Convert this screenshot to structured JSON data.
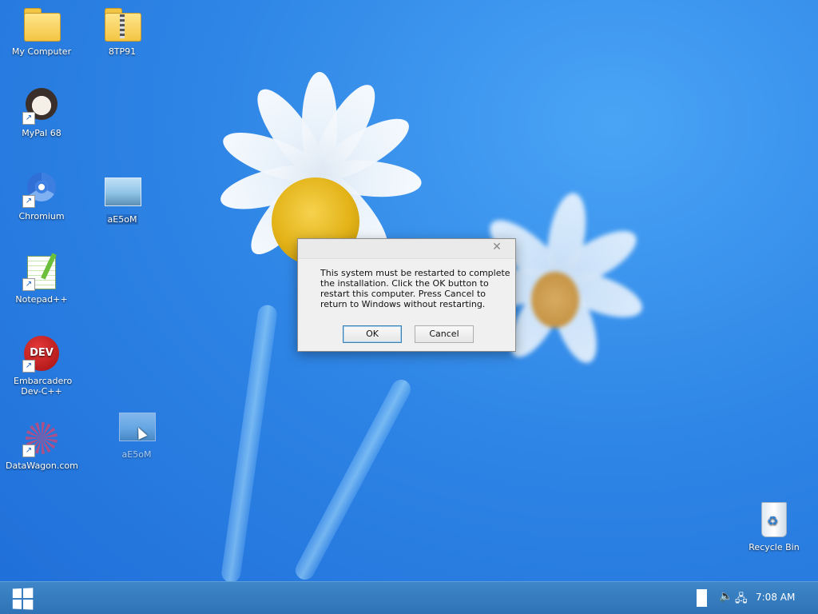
{
  "desktop": {
    "icons": [
      {
        "label": "My Computer",
        "icon": "folder-icon"
      },
      {
        "label": "8TP91",
        "icon": "zip-folder-icon"
      },
      {
        "label": "MyPal 68",
        "icon": "raccoon-icon"
      },
      {
        "label": "Chromium",
        "icon": "chromium-icon"
      },
      {
        "label": "aE5oM",
        "icon": "image-file-icon"
      },
      {
        "label": "Notepad++",
        "icon": "notepad-icon"
      },
      {
        "label": "Embarcadero Dev-C++",
        "icon": "devcpp-icon"
      },
      {
        "label": "DataWagon.com",
        "icon": "datawagon-icon"
      },
      {
        "label": "aE5oM",
        "icon": "image-file-icon"
      },
      {
        "label": "Recycle Bin",
        "icon": "recycle-bin-icon"
      }
    ],
    "dev_badge_text": "DEV"
  },
  "dialog": {
    "close_glyph": "✕",
    "message_lines": [
      "This system must be restarted to complete",
      "the installation. Click the OK button to",
      "restart this computer. Press Cancel to",
      "return to Windows without restarting."
    ],
    "ok_label": "OK",
    "cancel_label": "Cancel"
  },
  "taskbar": {
    "clock": "7:08 AM",
    "volume_glyph": "🔈",
    "network_glyph": "🖧"
  },
  "colors": {
    "taskbar": "#3a80c4",
    "desktop_blue": "#2f86e6"
  }
}
